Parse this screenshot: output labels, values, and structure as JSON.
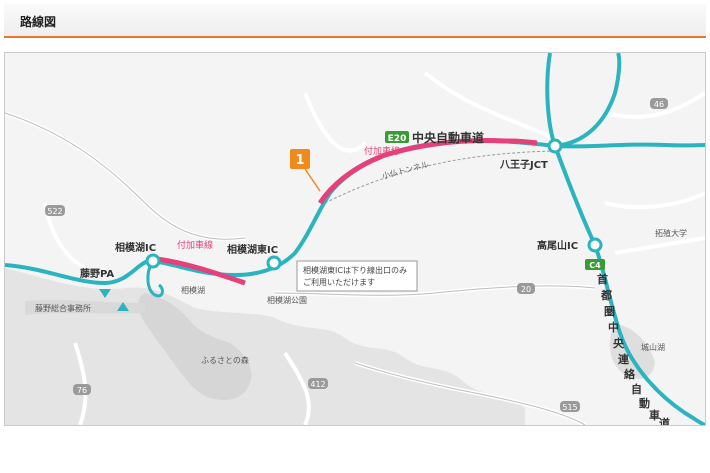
{
  "header": {
    "title": "路線図"
  },
  "map": {
    "route_label": "中央自動車道",
    "route_shield": "E20",
    "route_shield_c4": "C4",
    "ken_o_label": "首都圏中央連絡自動車道",
    "callout_number": "1",
    "interchanges": {
      "sagamiko_ic": "相模湖IC",
      "sagamiko_higashi_ic": "相模湖東IC",
      "hachioji_jct": "八王子JCT",
      "takaosan_ic": "高尾山IC",
      "fujino_pa": "藤野PA"
    },
    "additional_lane_1": "付加車線",
    "additional_lane_2": "付加車線",
    "tunnel": "小仏トンネル",
    "note_line1": "相模湖東ICは下り線出口のみ",
    "note_line2": "ご利用いただけます",
    "places": {
      "sagamiko_lake": "相模湖",
      "sagamiko_park": "相模湖公園",
      "furusato_mori": "ふるさとの森",
      "fujino_office": "藤野総合事務所",
      "takushoku_univ": "拓殖大学",
      "shiroyama_lake": "城山湖"
    },
    "road_numbers": {
      "r522": "522",
      "r46": "46",
      "r20": "20",
      "r412": "412",
      "r515": "515",
      "r76": "76"
    },
    "colors": {
      "route": "#2bb3bf",
      "lane": "#e5407a",
      "shield_green": "#3a9b36",
      "callout": "#f08a1c",
      "header_rule": "#e8762b"
    }
  }
}
